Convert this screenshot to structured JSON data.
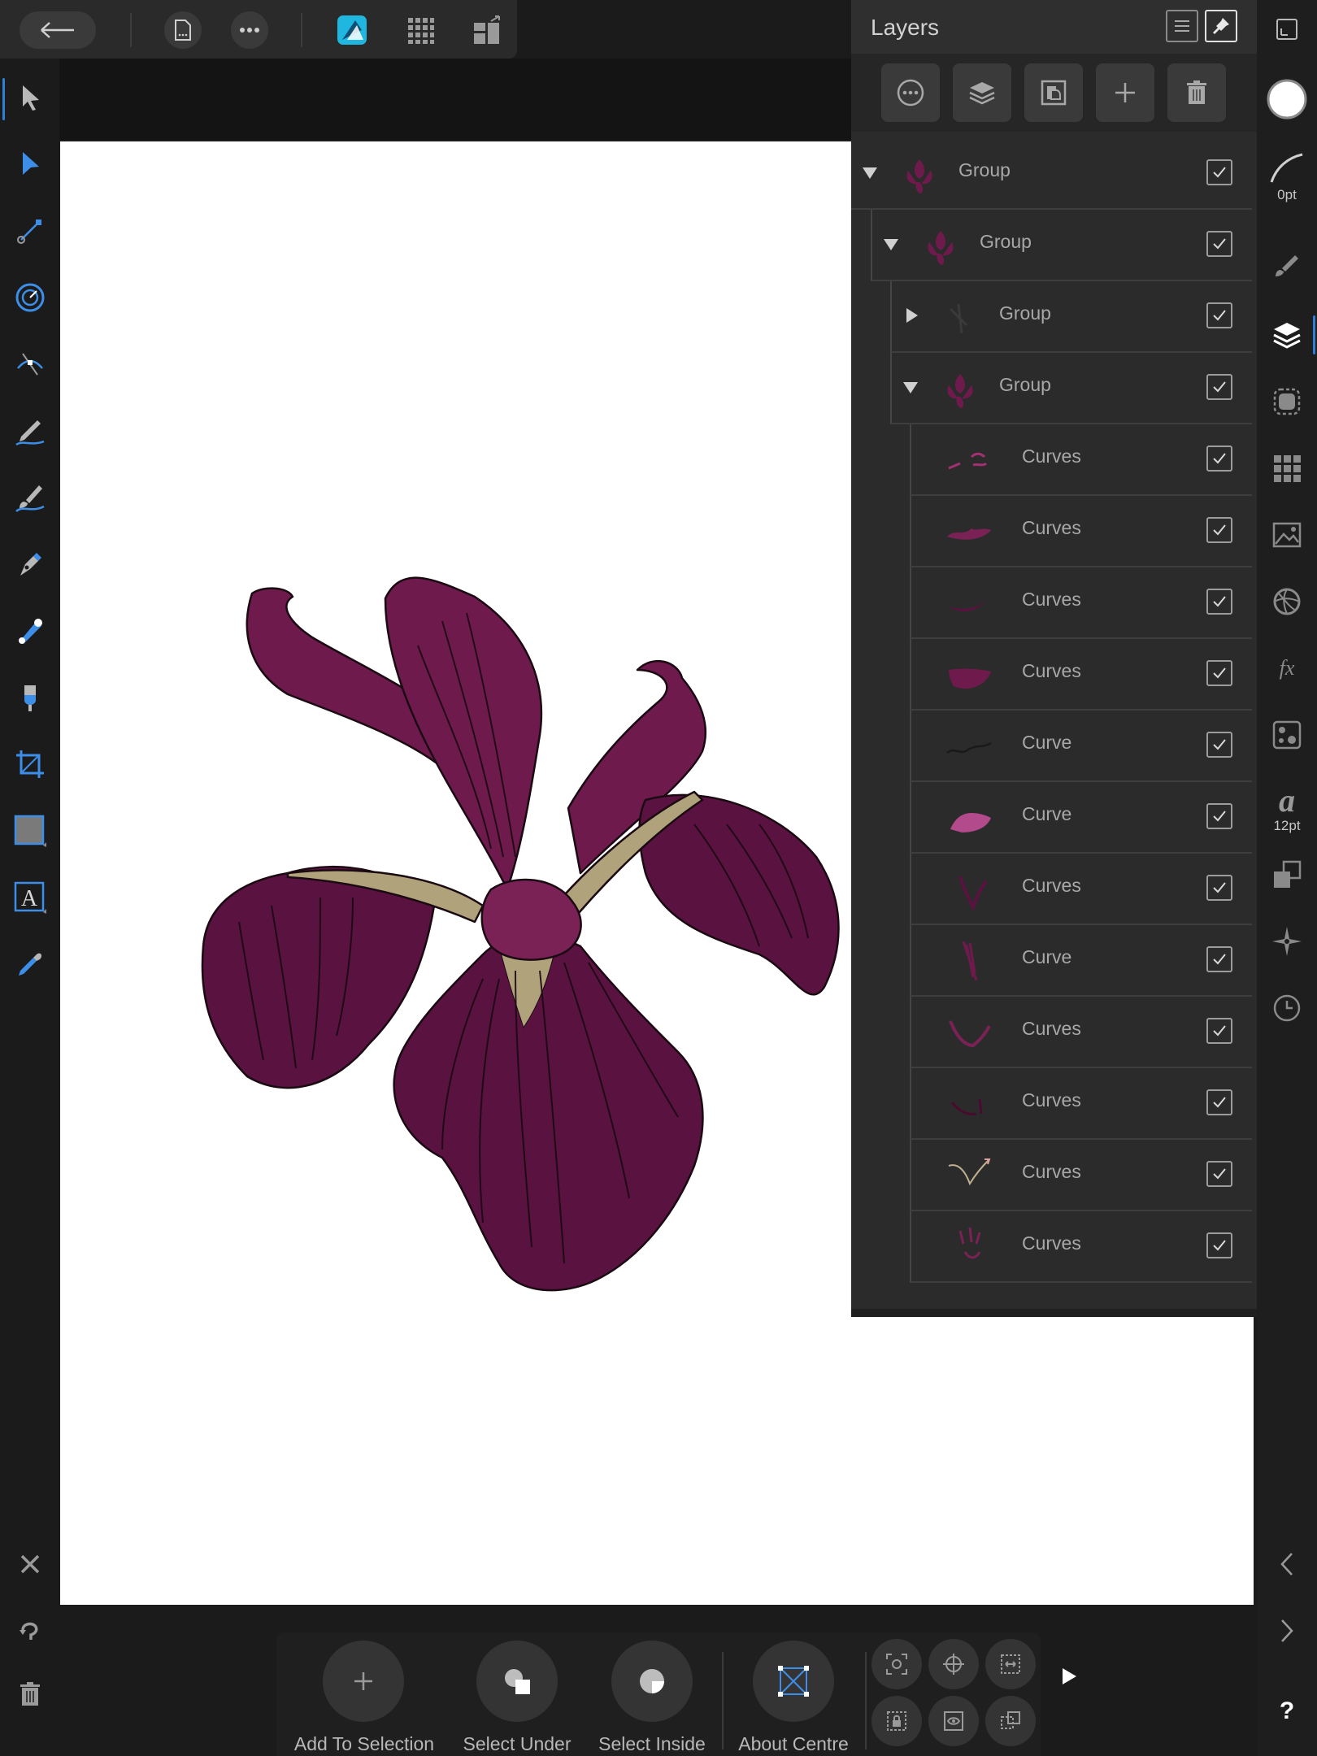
{
  "topbar": {
    "back_icon": "back-arrow-icon",
    "document_icon": "document-menu-icon",
    "more_icon": "more-icon",
    "persona_icon": "designer-persona-icon",
    "pixel_persona_icon": "pixel-persona-icon",
    "export_persona_icon": "export-persona-icon"
  },
  "left_tools": [
    "move-tool",
    "node-tool",
    "point-transform-tool",
    "corner-tool",
    "contour-tool",
    "pencil-tool",
    "vector-brush-tool",
    "pen-tool",
    "fill-tool",
    "transparency-tool",
    "crop-tool",
    "rectangle-tool",
    "artistic-text-tool",
    "color-picker-tool"
  ],
  "left_bottom": [
    "close-icon",
    "undo-icon",
    "delete-icon"
  ],
  "right_strip": {
    "stroke_width": "0pt",
    "font_size": "12pt",
    "items": [
      "navigator",
      "fill-color",
      "stroke",
      "brushes",
      "layers",
      "effects-studio",
      "swatches",
      "stock",
      "color",
      "fx",
      "styles",
      "text-styles",
      "transform",
      "snapping",
      "history"
    ],
    "prev_icon": "chevron-left-icon",
    "next_icon": "chevron-right-icon",
    "help": "?"
  },
  "layers": {
    "title": "Layers",
    "rows": [
      {
        "name": "Group",
        "indent": 0,
        "expanded": "down",
        "checked": true
      },
      {
        "name": "Group",
        "indent": 1,
        "expanded": "down",
        "checked": true
      },
      {
        "name": "Group",
        "indent": 2,
        "expanded": "right",
        "checked": true
      },
      {
        "name": "Group",
        "indent": 2,
        "expanded": "down",
        "checked": true
      },
      {
        "name": "Curves",
        "indent": 3,
        "checked": true
      },
      {
        "name": "Curves",
        "indent": 3,
        "checked": true
      },
      {
        "name": "Curves",
        "indent": 3,
        "checked": true
      },
      {
        "name": "Curves",
        "indent": 3,
        "checked": true
      },
      {
        "name": "Curve",
        "indent": 3,
        "checked": true
      },
      {
        "name": "Curve",
        "indent": 3,
        "checked": true
      },
      {
        "name": "Curves",
        "indent": 3,
        "checked": true
      },
      {
        "name": "Curve",
        "indent": 3,
        "checked": true
      },
      {
        "name": "Curves",
        "indent": 3,
        "checked": true
      },
      {
        "name": "Curves",
        "indent": 3,
        "checked": true
      },
      {
        "name": "Curves",
        "indent": 3,
        "checked": true
      },
      {
        "name": "Curves",
        "indent": 3,
        "checked": true
      }
    ]
  },
  "bottom_bar": {
    "add_to_selection": "Add To Selection",
    "select_under": "Select Under",
    "select_inside": "Select Inside",
    "about_centre": "About Centre"
  },
  "colors": {
    "accent": "#2f7fd6",
    "petal_dark": "#4a0a2e",
    "petal_mid": "#6e1a4c",
    "petal_light": "#8a3066",
    "petal_tan": "#b0a27a"
  }
}
